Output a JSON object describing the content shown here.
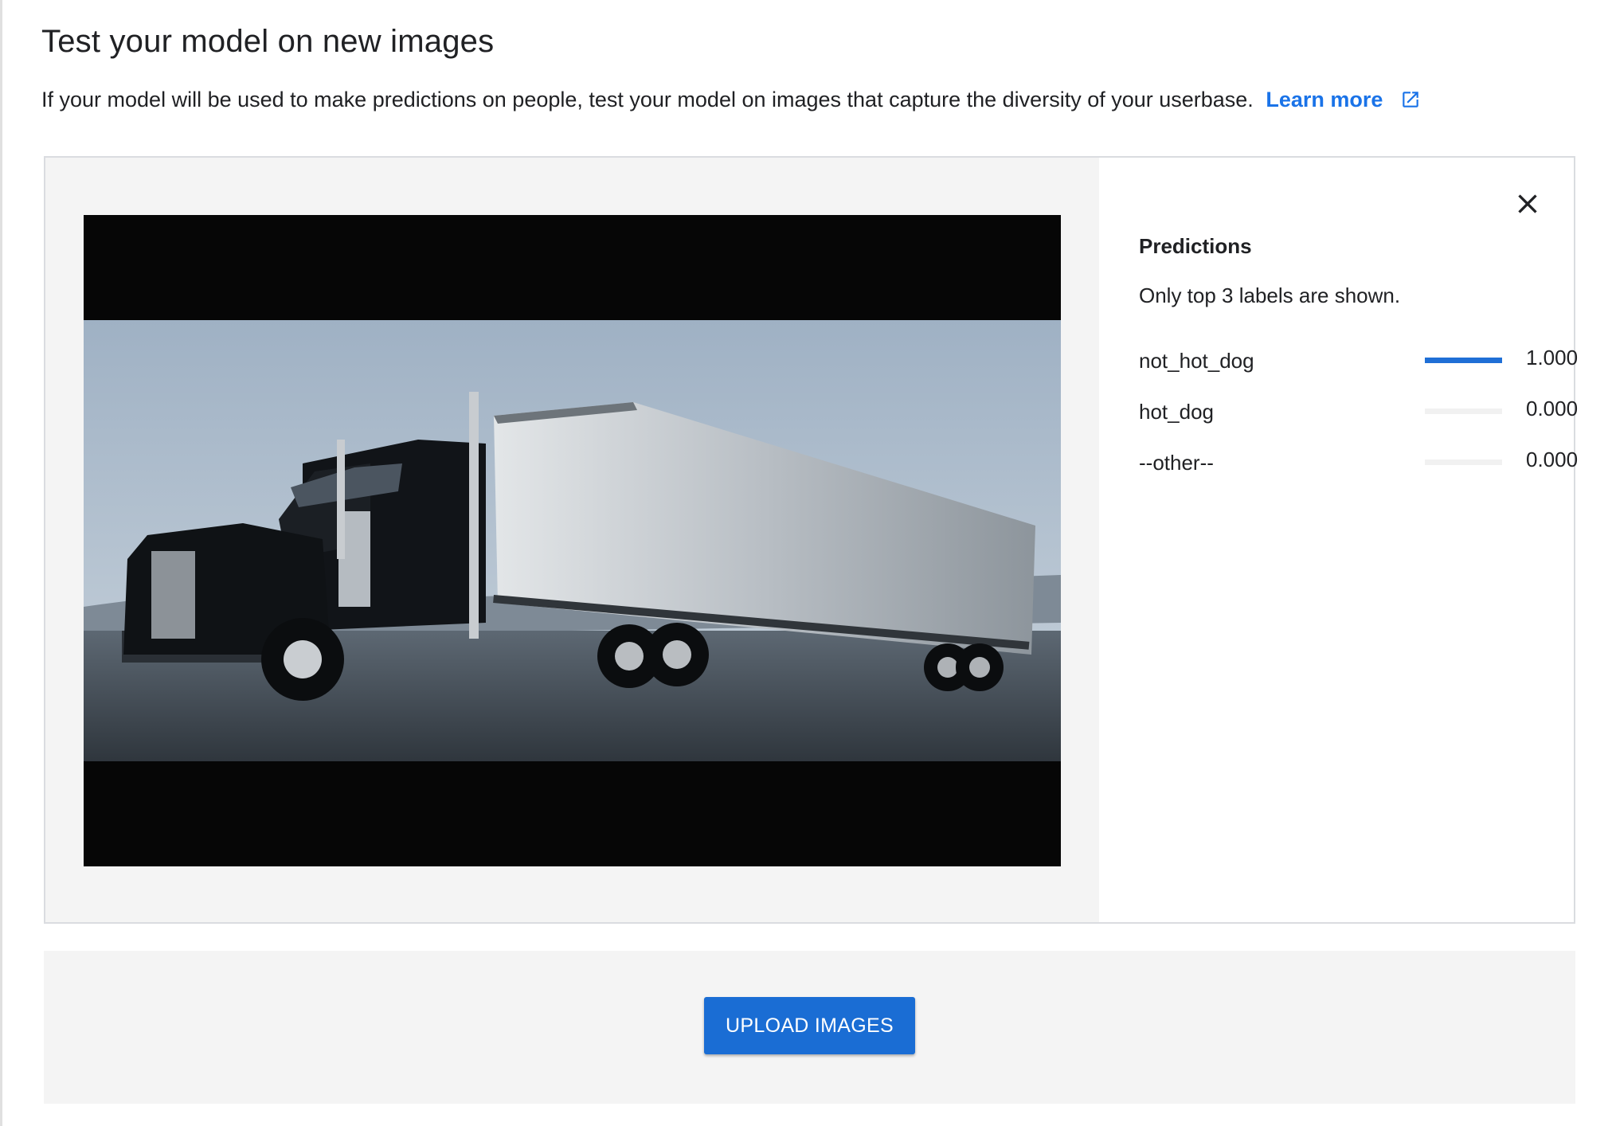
{
  "header": {
    "title": "Test your model on new images",
    "description": "If your model will be used to make predictions on people, test your model on images that capture the diversity of your userbase.",
    "learn_more_label": "Learn more"
  },
  "preview": {
    "image_alt": "Black semi truck with white trailer"
  },
  "predictions": {
    "title": "Predictions",
    "note": "Only top 3 labels are shown.",
    "items": [
      {
        "label": "not_hot_dog",
        "score": "1.000",
        "fraction": 1.0
      },
      {
        "label": "hot_dog",
        "score": "0.000",
        "fraction": 0.0
      },
      {
        "label": "--other--",
        "score": "0.000",
        "fraction": 0.0
      }
    ]
  },
  "actions": {
    "upload_label": "UPLOAD IMAGES"
  },
  "colors": {
    "accent": "#1a73e8",
    "bar_fill": "#1f6fd6",
    "panel_bg": "#f4f4f4"
  },
  "icons": {
    "external_link": "external-link-icon",
    "close": "close-icon"
  }
}
